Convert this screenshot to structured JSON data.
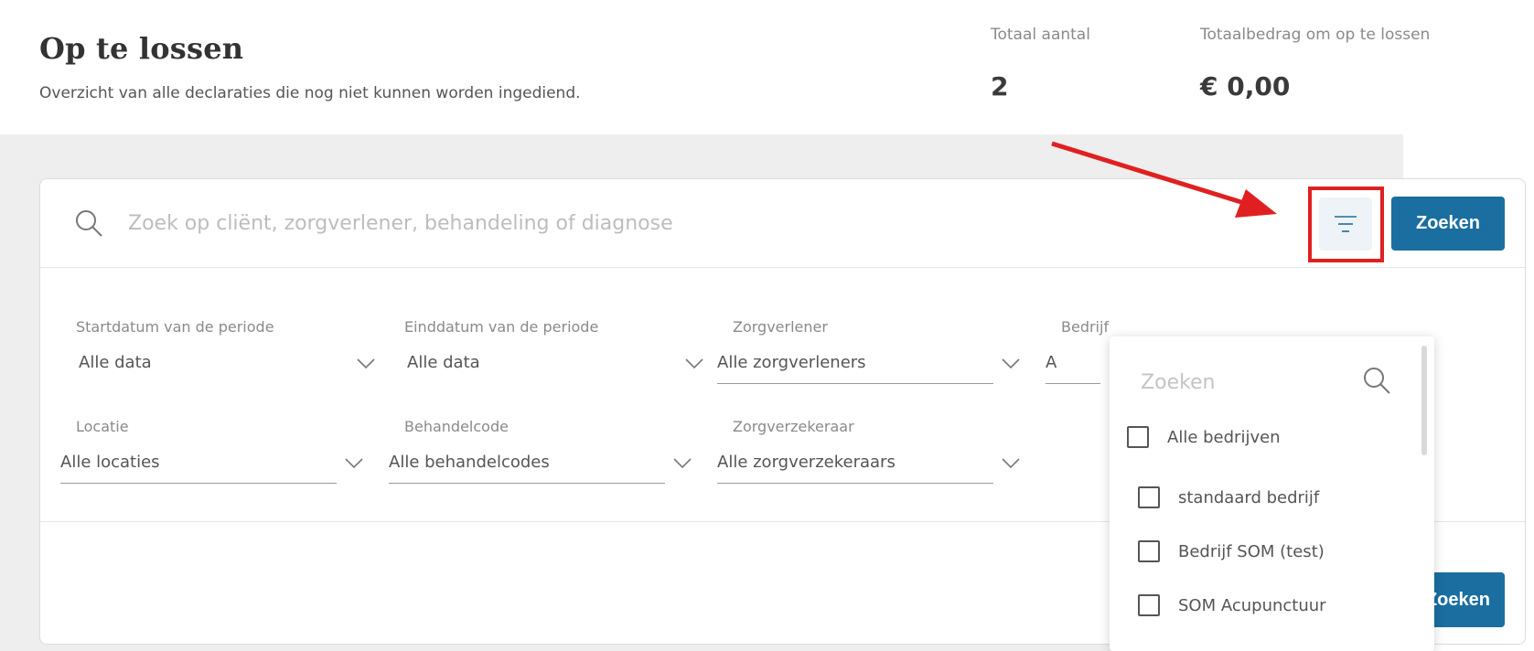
{
  "header": {
    "title": "Op te lossen",
    "subtitle": "Overzicht van alle declaraties die nog niet kunnen worden ingediend.",
    "stats": [
      {
        "label": "Totaal aantal",
        "value": "2"
      },
      {
        "label": "Totaalbedrag om op te lossen",
        "value": "€ 0,00"
      }
    ]
  },
  "search": {
    "placeholder": "Zoek op cliënt, zorgverlener, behandeling of diagnose",
    "search_button": "Zoeken"
  },
  "filters": {
    "start_date": {
      "label": "Startdatum van de periode",
      "value": "Alle data"
    },
    "end_date": {
      "label": "Einddatum van de periode",
      "value": "Alle data"
    },
    "provider": {
      "label": "Zorgverlener",
      "value": "Alle zorgverleners"
    },
    "company": {
      "label": "Bedrijf",
      "value": "A"
    },
    "location": {
      "label": "Locatie",
      "value": "Alle locaties"
    },
    "treatment_code": {
      "label": "Behandelcode",
      "value": "Alle behandelcodes"
    },
    "insurer": {
      "label": "Zorgverzekeraar",
      "value": "Alle zorgverzekeraars"
    }
  },
  "bottom_button": "Zoeken",
  "company_dropdown": {
    "search_placeholder": "Zoeken",
    "items": [
      {
        "label": "Alle bedrijven",
        "checked": false
      },
      {
        "label": "standaard bedrijf",
        "checked": false
      },
      {
        "label": "Bedrijf SOM (test)",
        "checked": false
      },
      {
        "label": "SOM Acupunctuur",
        "checked": false
      }
    ]
  },
  "colors": {
    "primary": "#1a6ea0",
    "highlight": "#e02020",
    "background_grey": "#eeeeee"
  }
}
